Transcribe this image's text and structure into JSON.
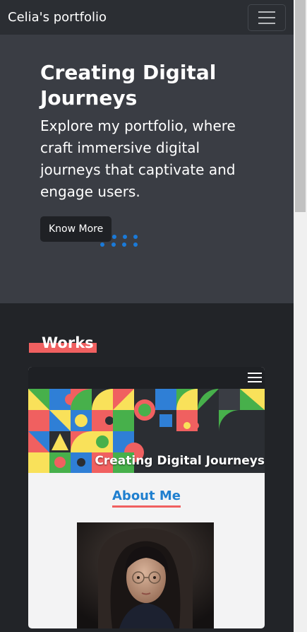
{
  "navbar": {
    "brand": "Celia's portfolio",
    "menu_icon": "hamburger-icon"
  },
  "hero": {
    "title": "Creating Digital Journeys",
    "text": "Explore my portfolio, where craft immersive digital journeys that captivate and engage users.",
    "button_label": "Know More"
  },
  "works": {
    "heading": "Works",
    "preview": {
      "menu_icon": "hamburger-icon",
      "banner_caption": "Creating Digital Journeys",
      "about_heading": "About Me"
    }
  },
  "colors": {
    "accent_red": "#f06060",
    "accent_blue": "#1f7fcf",
    "loader_blue": "#1a7ad9"
  }
}
